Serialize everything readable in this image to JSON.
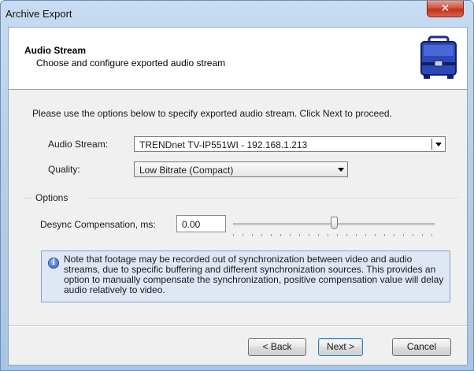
{
  "window": {
    "title": "Archive Export",
    "close_glyph": "✕"
  },
  "header": {
    "title": "Audio Stream",
    "subtitle": "Choose and configure exported audio stream",
    "icon": "briefcase-icon"
  },
  "instruction": "Please use the options below to specify exported audio stream. Click Next to proceed.",
  "audio_stream": {
    "label": "Audio Stream:",
    "value": "TRENDnet TV-IP551WI - 192.168.1.213"
  },
  "quality": {
    "label": "Quality:",
    "value": "Low Bitrate (Compact)"
  },
  "options": {
    "group_label": "Options",
    "desync_label": "Desync Compensation, ms:",
    "desync_value": "0.00",
    "slider_position": 0.5
  },
  "note": {
    "icon": "info-icon",
    "icon_glyph": "i",
    "text": "Note that footage may be recorded out of synchronization between video and audio streams, due to specific buffering and different synchronization sources. This provides an option to manually compensate the synchronization, positive compensation value will delay audio relatively to video."
  },
  "buttons": {
    "back": "< Back",
    "next": "Next >",
    "cancel": "Cancel"
  }
}
